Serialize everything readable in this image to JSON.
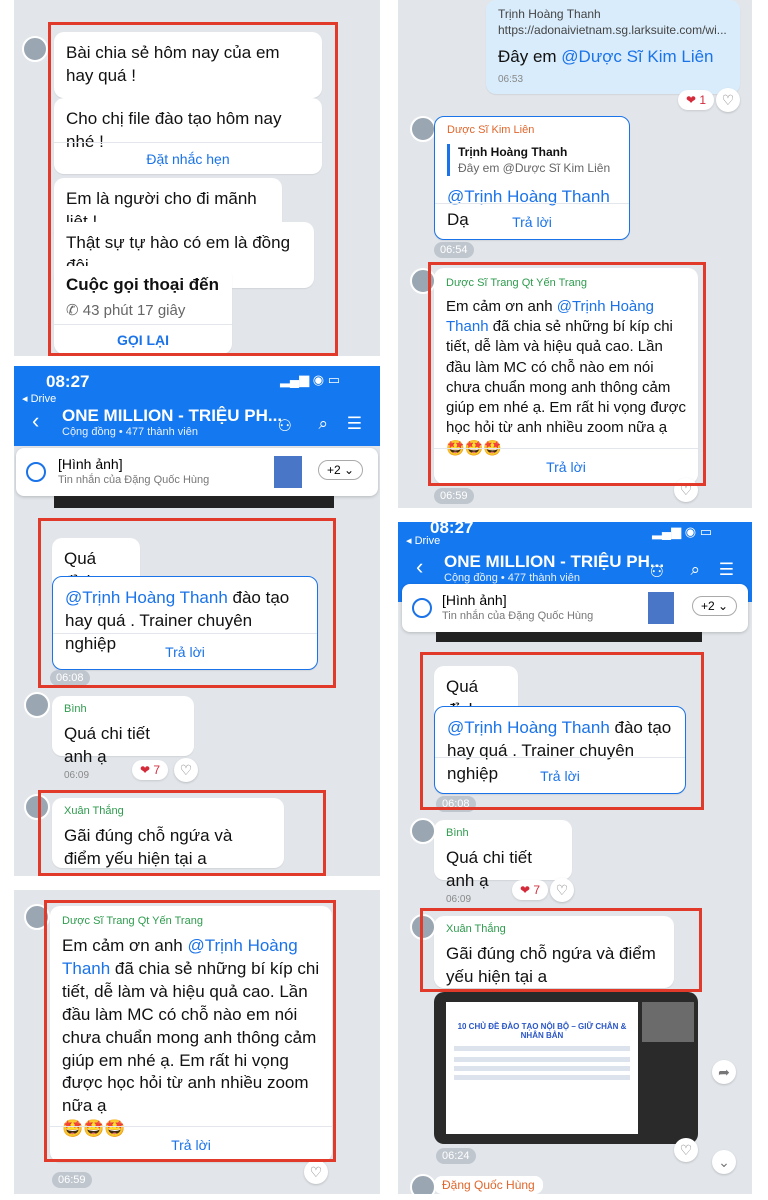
{
  "panel1": {
    "msgs": [
      "Bài chia sẻ hôm nay của em hay quá !",
      "Cho chị file đào tạo hôm nay nhé !",
      "Em là người cho đi mãnh liệt !",
      "Thật sự tự hào có em là đồng đội"
    ],
    "reminder": "Đặt nhắc hẹn",
    "call_title": "Cuộc gọi thoại đến",
    "call_duration": "43 phút 17 giây",
    "call_back": "GỌI LẠI"
  },
  "panel2": {
    "status_time": "08:27",
    "back_label": "◂ Drive",
    "group_name": "ONE MILLION - TRIỆU PH...",
    "group_sub": "Cộng đồng • 477 thành viên",
    "pinned_title": "[Hình ảnh]",
    "pinned_sub": "Tin nhắn của Đặng Quốc Hùng",
    "pinned_more": "+2",
    "msg1": "Quá đỉnh",
    "reply_mention": "@Trịnh Hoàng Thanh",
    "reply_text": " đào tạo hay quá . Trainer chuyên nghiệp",
    "reply_link": "Trả lời",
    "time1": "06:08",
    "binh_name": "Bình",
    "binh_msg": "Quá chi tiết anh ạ",
    "binh_time": "06:09",
    "binh_react": "❤ 7",
    "thang_name": "Xuân Thắng",
    "thang_msg": "Gãi đúng chỗ ngứa và điểm yếu hiện tại a"
  },
  "panel3": {
    "sender": "Dược Sĩ Trang Qt Yến Trang",
    "msg_pre": "Em cảm ơn anh ",
    "msg_mention": "@Trịnh Hoàng Thanh",
    "msg_post": " đã chia sẻ những bí kíp chi tiết, dễ làm và hiệu quả cao. Lần đầu làm MC có chỗ nào em nói chưa chuẩn mong anh thông cảm giúp em nhé ạ. Em rất hi vọng được học hỏi từ anh nhiều zoom nữa ạ",
    "emojis": "🤩🤩🤩",
    "reply_link": "Trả lời",
    "time": "06:59"
  },
  "panel4": {
    "top_name": "Trịnh Hoàng Thanh",
    "top_link": "https://adonaivietnam.sg.larksuite.com/wi...",
    "top_msg_pre": "Đây em ",
    "top_msg_mention": "@Dược Sĩ Kim Liên",
    "top_time": "06:53",
    "top_react": "❤ 1",
    "kl_sender": "Dược Sĩ Kim Liên",
    "kl_quote_name": "Trịnh Hoàng Thanh",
    "kl_quote_text": "Đây em @Dược Sĩ Kim Liên",
    "kl_mention": "@Trịnh Hoàng Thanh",
    "kl_text": " Dạ",
    "kl_reply": "Trả lời",
    "kl_time": "06:54",
    "trang_time": "06:59"
  },
  "panel5": {
    "status_time": "08:27",
    "back_label": "◂ Drive",
    "group_name": "ONE MILLION - TRIỆU PH...",
    "group_sub": "Cộng đồng • 477 thành viên",
    "pinned_title": "[Hình ảnh]",
    "pinned_sub": "Tin nhắn của Đặng Quốc Hùng",
    "pinned_more": "+2",
    "time1": "06:08",
    "video_title": "10 CHỦ ĐỀ ĐÀO TẠO NỘI BỘ – GIỮ CHÂN & NHÂN BẢN",
    "video_time": "06:24",
    "last_sender": "Đặng Quốc Hùng"
  }
}
